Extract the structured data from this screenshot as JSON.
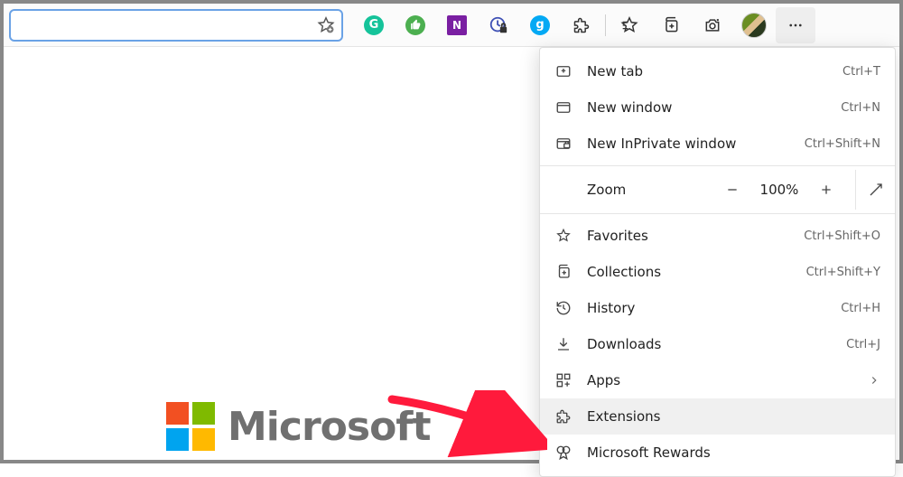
{
  "toolbar": {
    "extensions": [
      {
        "name": "grammarly",
        "letter": "G",
        "bg": "#15c39a"
      },
      {
        "name": "thumbs-up",
        "letter": "👍",
        "bg": "#4caf50"
      },
      {
        "name": "onenote",
        "letter": "N",
        "bg": "#7a1fa2"
      },
      {
        "name": "clock-lock",
        "letter": "",
        "bg": "transparent"
      },
      {
        "name": "circle-g",
        "letter": "g",
        "bg": "#03a9f4"
      }
    ]
  },
  "page": {
    "brand": "Microsoft"
  },
  "menu": {
    "items": [
      {
        "icon": "new-tab",
        "label": "New tab",
        "shortcut": "Ctrl+T"
      },
      {
        "icon": "new-window",
        "label": "New window",
        "shortcut": "Ctrl+N"
      },
      {
        "icon": "inprivate",
        "label": "New InPrivate window",
        "shortcut": "Ctrl+Shift+N"
      }
    ],
    "zoom": {
      "label": "Zoom",
      "value": "100%"
    },
    "items2": [
      {
        "icon": "favorites",
        "label": "Favorites",
        "shortcut": "Ctrl+Shift+O"
      },
      {
        "icon": "collections",
        "label": "Collections",
        "shortcut": "Ctrl+Shift+Y"
      },
      {
        "icon": "history",
        "label": "History",
        "shortcut": "Ctrl+H"
      },
      {
        "icon": "downloads",
        "label": "Downloads",
        "shortcut": "Ctrl+J"
      },
      {
        "icon": "apps",
        "label": "Apps",
        "submenu": true
      },
      {
        "icon": "extensions",
        "label": "Extensions",
        "highlighted": true
      },
      {
        "icon": "rewards",
        "label": "Microsoft Rewards"
      }
    ]
  }
}
